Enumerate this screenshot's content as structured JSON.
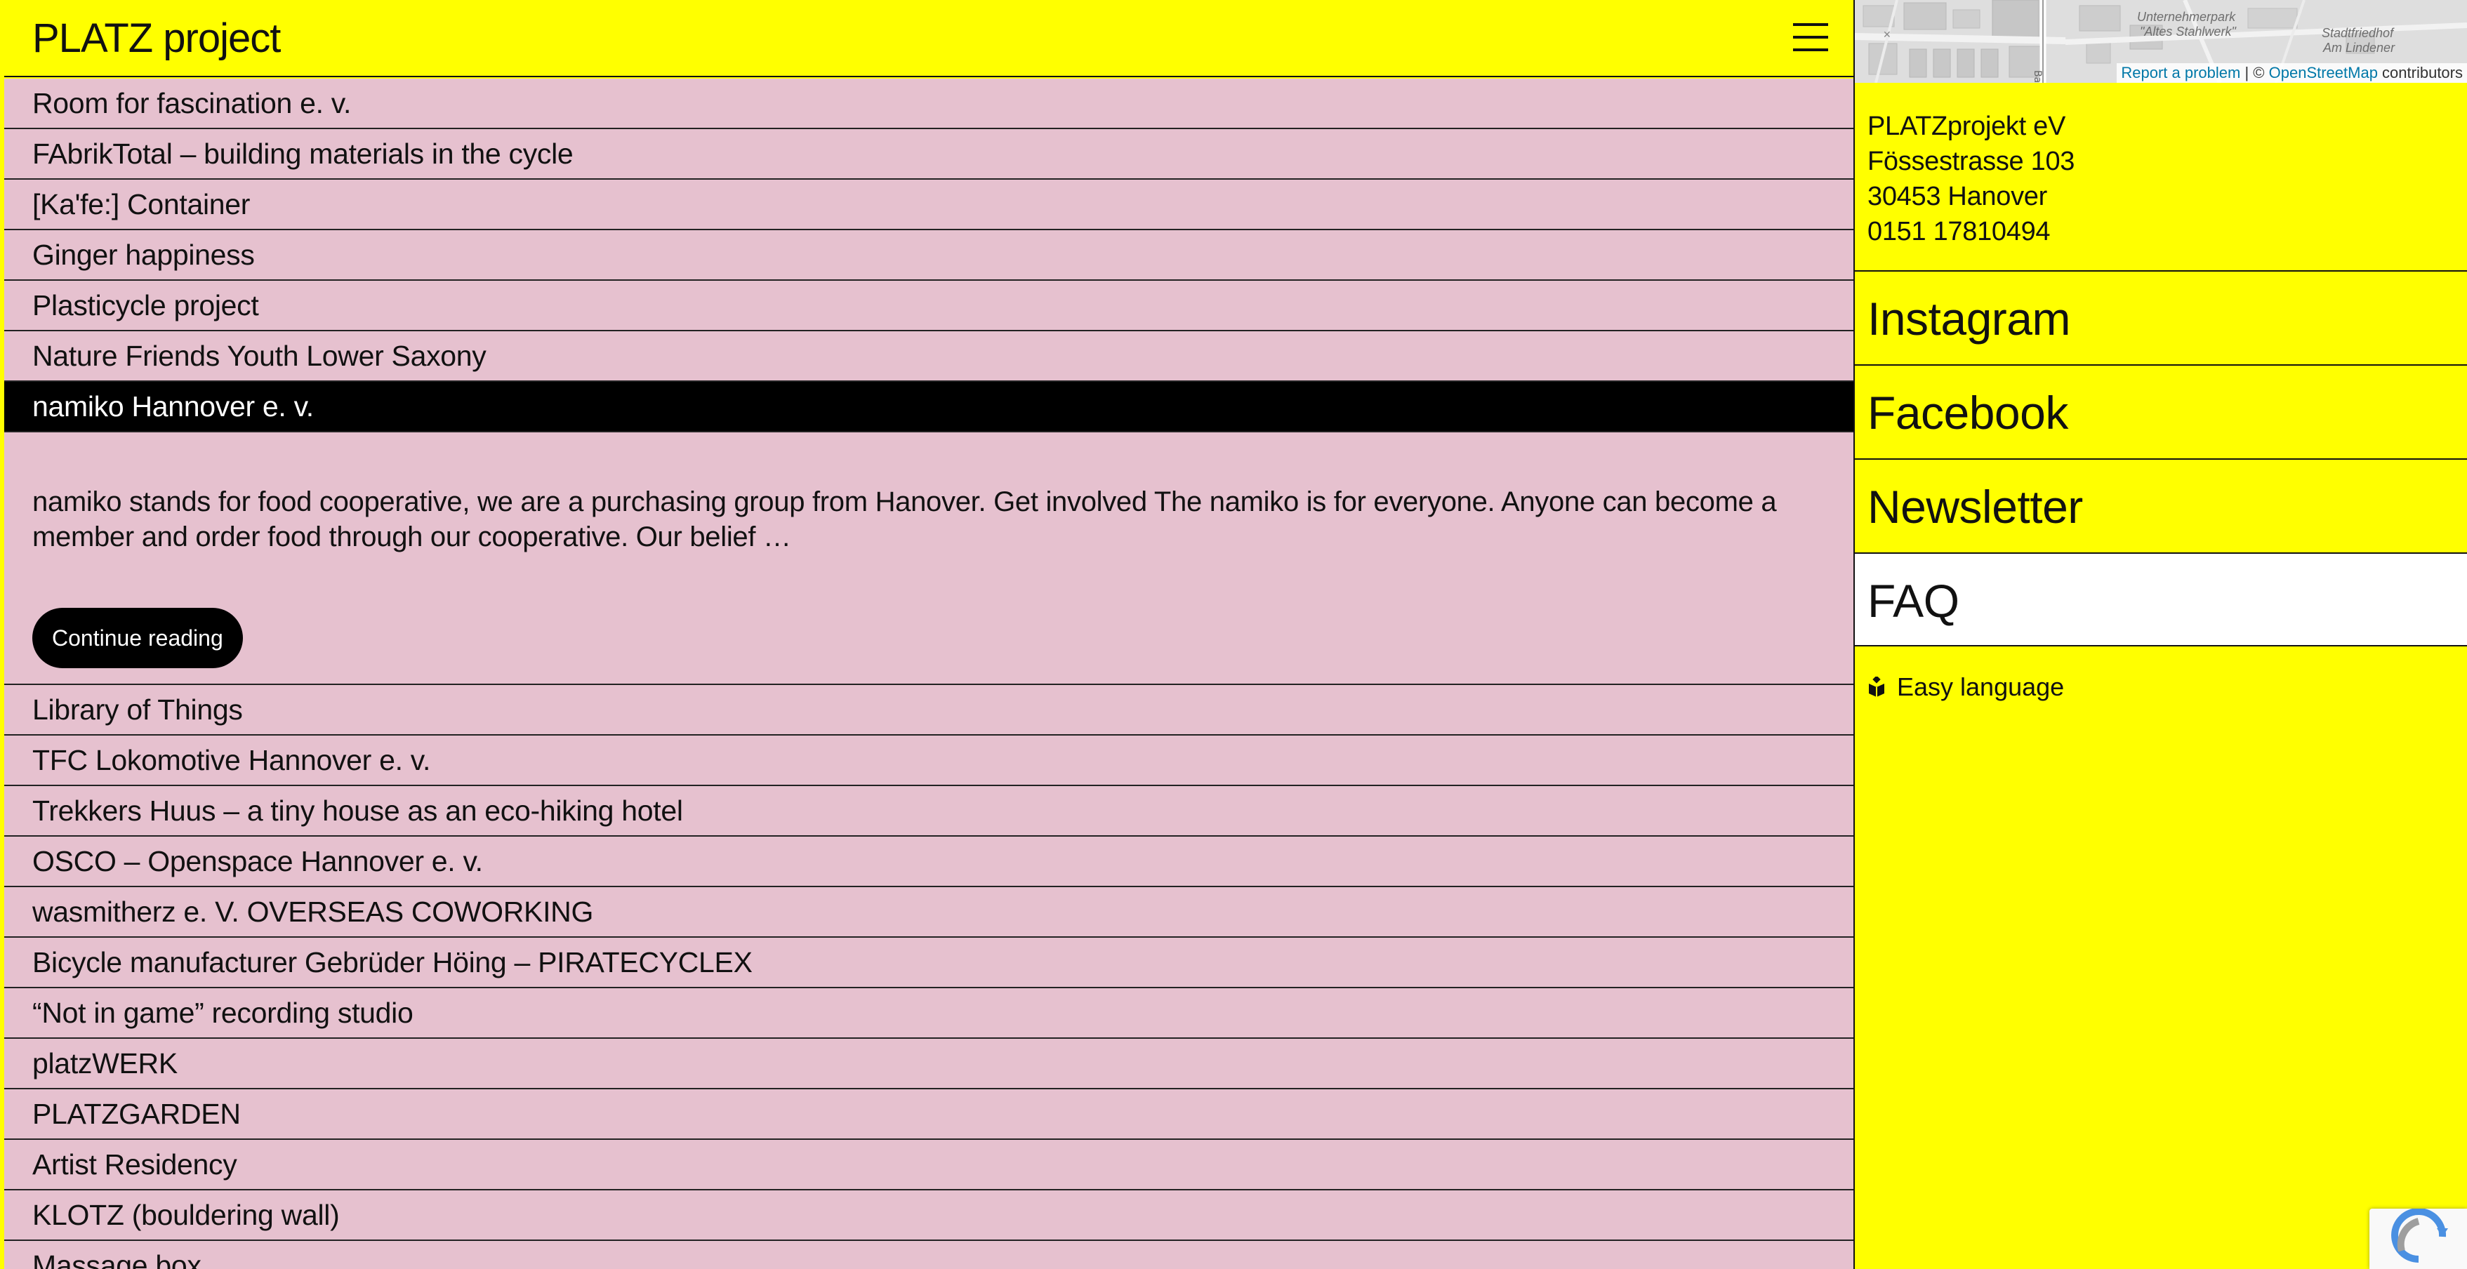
{
  "header": {
    "site_title": "PLATZ project"
  },
  "projects": {
    "before_active": [
      "Room for fascination e. v.",
      "FAbrikTotal – building materials in the cycle",
      "[Ka'fe:] Container",
      "Ginger happiness",
      "Plasticycle project",
      "Nature Friends Youth Lower Saxony"
    ],
    "active": {
      "title": "namiko Hannover e. v.",
      "excerpt": "namiko stands for food cooperative, we are a purchasing group from Hanover. Get involved The namiko is for everyone. Anyone can become a member and order food through our cooperative. Our belief …",
      "continue_label": "Continue reading"
    },
    "after_active": [
      "Library of Things",
      "TFC Lokomotive Hannover e. v.",
      "Trekkers Huus – a tiny house as an eco-hiking hotel",
      "OSCO – Openspace Hannover e. v.",
      "wasmitherz e. V. OVERSEAS COWORKING",
      "Bicycle manufacturer Gebrüder Höing – PIRATECYCLEX",
      "“Not in game” recording studio",
      "platzWERK",
      "PLATZGARDEN",
      "Artist Residency",
      "KLOTZ (bouldering wall)",
      "Massage box"
    ]
  },
  "map": {
    "labels": [
      "Unternehmerpark",
      "\"Altes Stahlwerk\"",
      "Stadtfriedhof",
      "Am Lindener"
    ],
    "report_link": "Report a problem",
    "separator": " | © ",
    "osm_link": "OpenStreetMap",
    "contributors": " contributors"
  },
  "address": {
    "name": "PLATZprojekt eV",
    "street": "Fössestrasse 103",
    "city": "30453 Hanover",
    "phone": "0151 17810494"
  },
  "social_links": [
    "Instagram",
    "Facebook",
    "Newsletter",
    "FAQ"
  ],
  "easy_language": {
    "label": "Easy language",
    "icon": "easy-language-icon"
  },
  "colors": {
    "accent_yellow": "#ffff00",
    "row_pink": "#e6c1cf",
    "active_black": "#000000"
  }
}
